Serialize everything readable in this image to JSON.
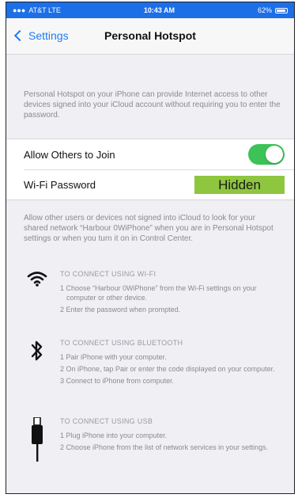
{
  "status_bar": {
    "carrier": "AT&T LTE",
    "time": "10:43 AM",
    "battery": "62%"
  },
  "nav": {
    "back_label": "Settings",
    "title": "Personal Hotspot"
  },
  "description": "Personal Hotspot on your iPhone can provide Internet access to other devices signed into your iCloud account without requiring you to enter the password.",
  "settings": {
    "allow_others": {
      "label": "Allow Others to Join",
      "enabled": true
    },
    "wifi_password": {
      "label": "Wi-Fi Password",
      "value": "Hidden"
    }
  },
  "help_text": "Allow other users or devices not signed into iCloud to look for your shared network “Harbour 0WiPhone” when you are in Personal Hotspot settings or when you turn it on in Control Center.",
  "instructions": {
    "wifi": {
      "icon": "wifi-icon",
      "heading": "TO CONNECT USING WI-FI",
      "steps": [
        "1 Choose “Harbour 0WiPhone” from the Wi-Fi settings on your computer or other device.",
        "2 Enter the password when prompted."
      ]
    },
    "bluetooth": {
      "icon": "bluetooth-icon",
      "heading": "TO CONNECT USING BLUETOOTH",
      "steps": [
        "1 Pair iPhone with your computer.",
        "2 On iPhone, tap Pair or enter the code displayed on your computer.",
        "3 Connect to iPhone from computer."
      ]
    },
    "usb": {
      "icon": "usb-cable-icon",
      "heading": "TO CONNECT USING USB",
      "steps": [
        "1 Plug iPhone into your computer.",
        "2 Choose iPhone from the list of network services in your settings."
      ]
    }
  },
  "colors": {
    "status_bar": "#1d6fe8",
    "accent": "#1f7cf2",
    "toggle_on": "#3cc257",
    "hidden_highlight": "#8ec63f"
  }
}
